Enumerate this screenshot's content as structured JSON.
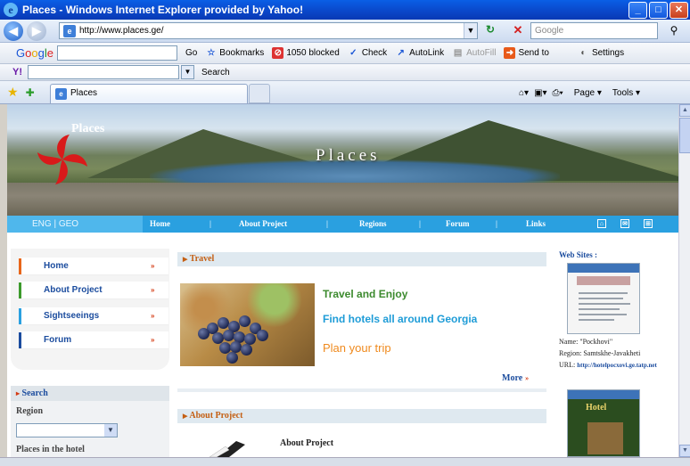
{
  "window": {
    "title": "Places - Windows Internet Explorer provided by Yahoo!",
    "minimize": "_",
    "maximize": "□",
    "close": "✕"
  },
  "address_bar": {
    "url": "http://www.places.ge/",
    "search_placeholder": "Google"
  },
  "google_toolbar": {
    "logo": "Google",
    "go_label": "Go",
    "bookmarks_label": "Bookmarks",
    "blocked_label": "1050 blocked",
    "check_label": "Check",
    "autolink_label": "AutoLink",
    "autofill_label": "AutoFill",
    "sendto_label": "Send to",
    "settings_label": "Settings"
  },
  "yahoo_toolbar": {
    "logo": "Y!",
    "search_label": "Search"
  },
  "tabs": [
    {
      "label": "Places"
    }
  ],
  "command_bar": {
    "page_label": "Page",
    "tools_label": "Tools"
  },
  "site": {
    "banner_site_name": "Places",
    "banner_title": "Places",
    "lang": "ENG  |  GEO",
    "nav": [
      "Home",
      "About Project",
      "Regions",
      "Forum",
      "Links"
    ],
    "left_menu": [
      {
        "label": "Home",
        "color": "#e8661a"
      },
      {
        "label": "About Project",
        "color": "#3c9a2c"
      },
      {
        "label": "Sightseeings",
        "color": "#2aa0e0"
      },
      {
        "label": "Forum",
        "color": "#1b4c9e"
      }
    ],
    "left_menu_arrow": "»",
    "search": {
      "header": "Search",
      "region_label": "Region",
      "places_label": "Places in the hotel"
    },
    "travel": {
      "header": "Travel",
      "line1": "Travel and Enjoy",
      "line2": "Find hotels all around Georgia",
      "line3": "Plan your trip",
      "more": "More"
    },
    "about": {
      "header": "About Project",
      "title": "About Project"
    },
    "web_sites": {
      "header": "Web Sites :",
      "name": "Name: \"Pockhovi\"",
      "region": "Region: Samtskhe-Javakheti",
      "url_label": "URL:",
      "url": "http://hotelpocxovi.ge.tatp.net",
      "thumb2_label": "Hotel"
    }
  }
}
